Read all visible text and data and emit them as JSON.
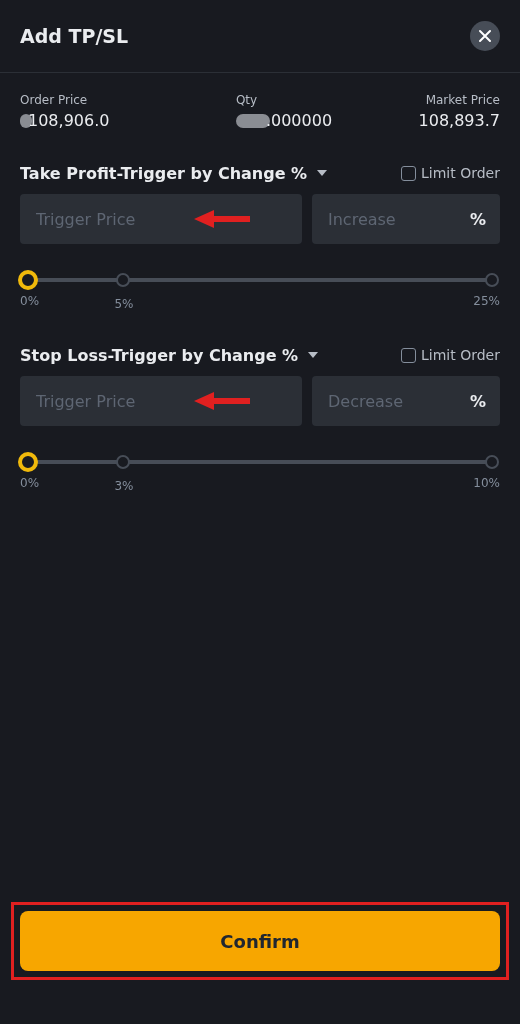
{
  "title": "Add TP/SL",
  "summary": [
    {
      "label": "Order Price",
      "value": "108,906.0",
      "redacted": true
    },
    {
      "label": "Qty",
      "value": ".000000",
      "redacted": true
    },
    {
      "label": "Market Price",
      "value": "108,893.7"
    }
  ],
  "sections": [
    {
      "heading": "Take Profit-Trigger by Change %",
      "limit_order": {
        "label": "Limit Order",
        "checked": false
      },
      "price_field": {
        "placeholder": "Trigger Price"
      },
      "change_field": {
        "placeholder": "Increase",
        "unit": "%"
      },
      "slider": {
        "level": 0,
        "ticks": [
          "0%",
          "5%",
          "25%"
        ]
      },
      "annotated": true
    },
    {
      "heading": "Stop Loss-Trigger by Change %",
      "limit_order": {
        "label": "Limit Order",
        "checked": false
      },
      "price_field": {
        "placeholder": "Trigger Price"
      },
      "change_field": {
        "placeholder": "Decrease",
        "unit": "%"
      },
      "slider": {
        "level": 0,
        "ticks": [
          "0%",
          "3%",
          "10%"
        ]
      },
      "annotated": true
    }
  ],
  "confirm": {
    "label": "Confirm",
    "highlighted": true
  }
}
